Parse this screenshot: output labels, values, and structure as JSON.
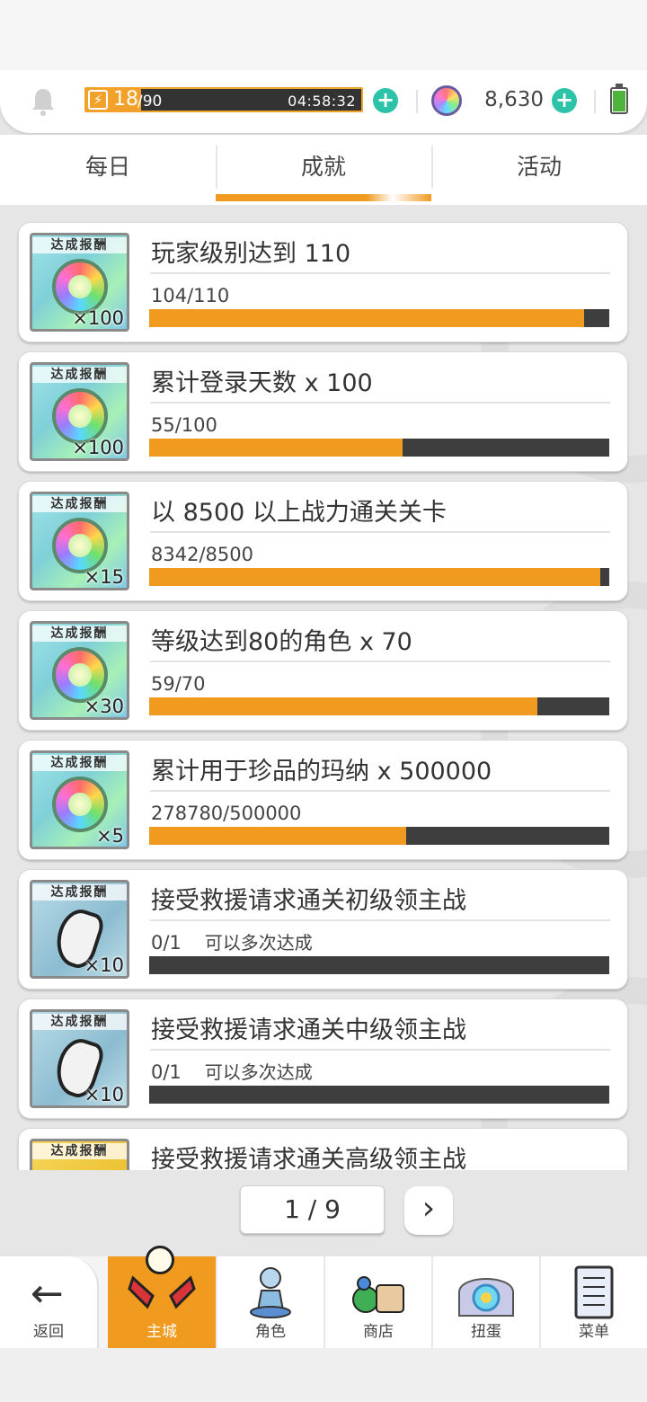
{
  "header": {
    "stamina_current": "18",
    "stamina_max": "/90",
    "stamina_fraction": 0.2,
    "stamina_timer": "04:58:32",
    "gem_count": "8,630"
  },
  "tabs": [
    {
      "label": "每日"
    },
    {
      "label": "成就"
    },
    {
      "label": "活动"
    }
  ],
  "achievements": [
    {
      "reward_label": "达成报酬",
      "reward_count": "×100",
      "reward_icon": "rainbow-gem-icon",
      "title": "玩家级别达到 110",
      "progress": "104/110",
      "note": "",
      "fraction": 0.945
    },
    {
      "reward_label": "达成报酬",
      "reward_count": "×100",
      "reward_icon": "rainbow-gem-icon",
      "title": "累计登录天数  x 100",
      "progress": "55/100",
      "note": "",
      "fraction": 0.55
    },
    {
      "reward_label": "达成报酬",
      "reward_count": "×15",
      "reward_icon": "rainbow-gem-icon",
      "title": "以 8500 以上战力通关关卡",
      "progress": "8342/8500",
      "note": "",
      "fraction": 0.981
    },
    {
      "reward_label": "达成报酬",
      "reward_count": "×30",
      "reward_icon": "rainbow-gem-icon",
      "title": "等级达到80的角色  x 70",
      "progress": "59/70",
      "note": "",
      "fraction": 0.843
    },
    {
      "reward_label": "达成报酬",
      "reward_count": "×5",
      "reward_icon": "rainbow-gem-icon",
      "title": "累计用于珍品的玛纳  x 500000",
      "progress": "278780/500000",
      "note": "",
      "fraction": 0.558
    },
    {
      "reward_label": "达成报酬",
      "reward_count": "×10",
      "reward_icon": "rock-icon",
      "title": "接受救援请求通关初级领主战",
      "progress": "0/1",
      "note": "可以多次达成",
      "fraction": 0
    },
    {
      "reward_label": "达成报酬",
      "reward_count": "×10",
      "reward_icon": "rock-icon",
      "title": "接受救援请求通关中级领主战",
      "progress": "0/1",
      "note": "可以多次达成",
      "fraction": 0
    },
    {
      "reward_label": "达成报酬",
      "reward_count": "",
      "reward_icon": "gold-item-icon",
      "title": "接受救援请求通关高级领主战",
      "progress": "",
      "note": "",
      "fraction": 0
    }
  ],
  "pager": {
    "text": "1 / 9"
  },
  "nav": {
    "back": "返回",
    "items": [
      {
        "label": "主城"
      },
      {
        "label": "角色"
      },
      {
        "label": "商店"
      },
      {
        "label": "扭蛋"
      },
      {
        "label": "菜单"
      }
    ]
  },
  "colors": {
    "accent": "#f19a20",
    "plus": "#2cc3a8",
    "bar_bg": "#3e3e3e"
  }
}
